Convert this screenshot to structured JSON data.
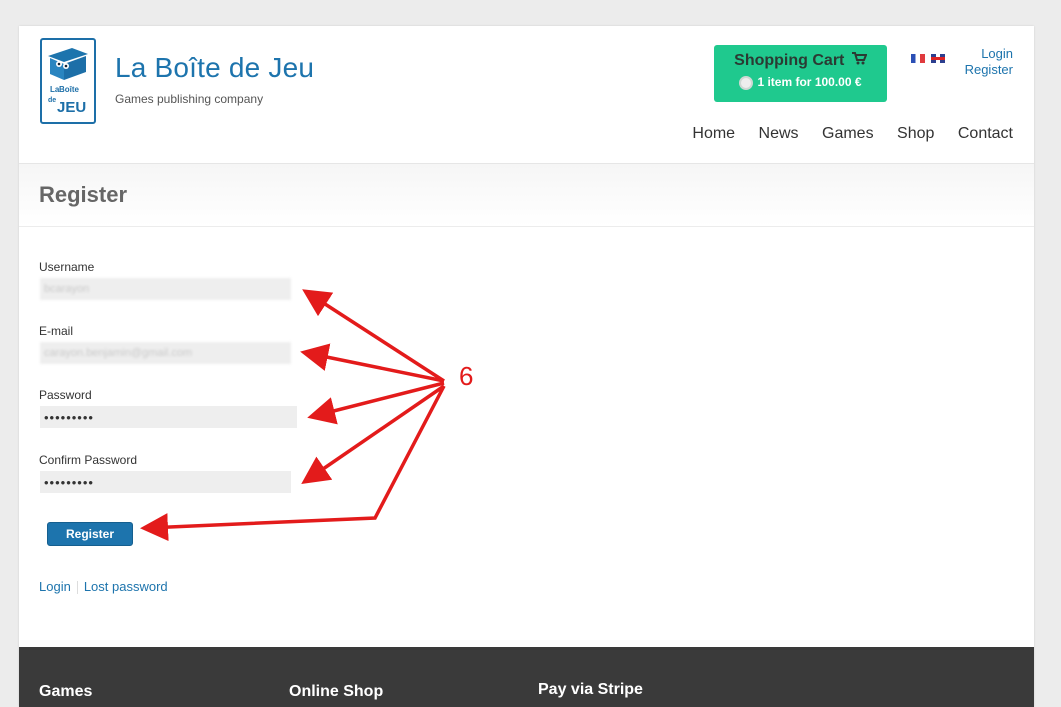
{
  "header": {
    "site_title": "La Boîte de Jeu",
    "tagline": "Games publishing company",
    "logo": {
      "line1": "La",
      "line2": "Boîte",
      "line3": "de",
      "line4": "JEU"
    },
    "cart": {
      "title": "Shopping Cart",
      "summary": "1 item for 100.00 €",
      "icon": "shopping-cart-icon"
    },
    "flags": [
      "flag-fr-icon",
      "flag-gb-icon"
    ],
    "account": {
      "login": "Login",
      "register": "Register"
    },
    "nav": [
      "Home",
      "News",
      "Games",
      "Shop",
      "Contact"
    ]
  },
  "page_title": "Register",
  "form": {
    "username_label": "Username",
    "username_value": "bcarayon",
    "email_label": "E-mail",
    "email_value": "carayon.benjamin@gmail.com",
    "password_label": "Password",
    "password_value": "•••••••••",
    "confirm_label": "Confirm Password",
    "confirm_value": "•••••••••",
    "submit_label": "Register"
  },
  "links": {
    "login": "Login",
    "lost_password": "Lost password"
  },
  "annotation": {
    "number": "6",
    "color": "#e31b1b"
  },
  "footer": {
    "col1": "Games",
    "col2": "Online Shop",
    "col3": "Pay via Stripe"
  },
  "colors": {
    "brand": "#1d74ad",
    "cart": "#1fc98e",
    "footer": "#3a3a3a"
  }
}
